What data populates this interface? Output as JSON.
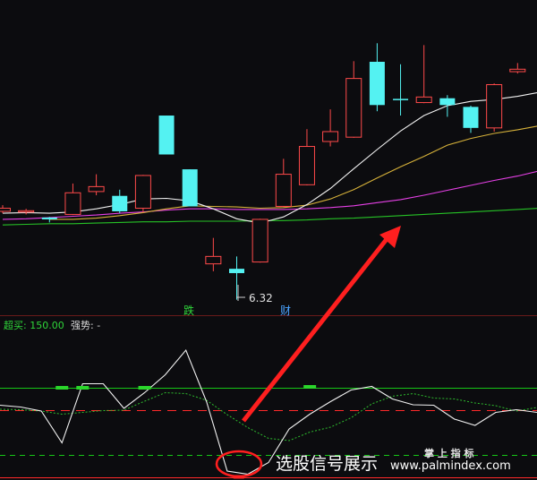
{
  "chart_data": {
    "type": "candlestick",
    "main": {
      "low_label": "6.32",
      "event_labels": [
        {
          "text": "跌",
          "color": "#2fd63a"
        },
        {
          "text": "财",
          "color": "#4aa3ff"
        }
      ],
      "candles": [
        {
          "o": 7.8,
          "c": 7.75,
          "h": 7.85,
          "l": 7.72,
          "color": "up"
        },
        {
          "o": 7.74,
          "c": 7.76,
          "h": 7.79,
          "l": 7.7,
          "color": "up"
        },
        {
          "o": 7.65,
          "c": 7.62,
          "h": 7.66,
          "l": 7.57,
          "color": "down"
        },
        {
          "o": 7.7,
          "c": 8.05,
          "h": 8.2,
          "l": 7.69,
          "color": "up"
        },
        {
          "o": 8.07,
          "c": 8.15,
          "h": 8.35,
          "l": 8.01,
          "color": "up"
        },
        {
          "o": 8.0,
          "c": 7.75,
          "h": 8.1,
          "l": 7.72,
          "color": "down"
        },
        {
          "o": 7.8,
          "c": 8.33,
          "h": 8.34,
          "l": 7.73,
          "color": "up"
        },
        {
          "o": 9.3,
          "c": 8.67,
          "h": 9.3,
          "l": 8.67,
          "color": "down"
        },
        {
          "o": 8.43,
          "c": 7.83,
          "h": 8.43,
          "l": 7.83,
          "color": "down"
        },
        {
          "o": 6.9,
          "c": 7.02,
          "h": 7.32,
          "l": 6.78,
          "color": "up"
        },
        {
          "o": 6.82,
          "c": 6.75,
          "h": 7.02,
          "l": 6.32,
          "color": "down"
        },
        {
          "o": 6.93,
          "c": 7.62,
          "h": 7.63,
          "l": 6.92,
          "color": "up"
        },
        {
          "o": 7.83,
          "c": 8.35,
          "h": 8.6,
          "l": 7.82,
          "color": "up"
        },
        {
          "o": 8.18,
          "c": 8.8,
          "h": 9.08,
          "l": 8.17,
          "color": "up"
        },
        {
          "o": 8.88,
          "c": 9.04,
          "h": 9.4,
          "l": 8.8,
          "color": "up"
        },
        {
          "o": 8.95,
          "c": 9.9,
          "h": 10.18,
          "l": 8.94,
          "color": "up"
        },
        {
          "o": 10.17,
          "c": 9.47,
          "h": 10.47,
          "l": 9.37,
          "color": "down"
        },
        {
          "o": 9.55,
          "c": 9.57,
          "h": 10.13,
          "l": 9.3,
          "color": "down"
        },
        {
          "o": 9.51,
          "c": 9.6,
          "h": 10.44,
          "l": 9.5,
          "color": "up"
        },
        {
          "o": 9.58,
          "c": 9.47,
          "h": 9.63,
          "l": 9.28,
          "color": "down"
        },
        {
          "o": 9.44,
          "c": 9.1,
          "h": 9.46,
          "l": 9.02,
          "color": "down"
        },
        {
          "o": 9.1,
          "c": 9.8,
          "h": 9.82,
          "l": 9.04,
          "color": "up"
        },
        {
          "o": 10.01,
          "c": 10.05,
          "h": 10.15,
          "l": 9.98,
          "color": "up"
        }
      ],
      "ma_white": [
        7.72,
        7.73,
        7.72,
        7.74,
        7.79,
        7.86,
        7.95,
        7.96,
        7.92,
        7.79,
        7.63,
        7.56,
        7.66,
        7.86,
        8.12,
        8.44,
        8.75,
        9.05,
        9.3,
        9.46,
        9.53,
        9.56,
        9.61,
        9.68
      ],
      "ma_yellow": [
        null,
        null,
        7.62,
        7.62,
        7.64,
        7.68,
        7.73,
        7.79,
        7.84,
        7.83,
        7.82,
        7.8,
        7.81,
        7.85,
        7.95,
        8.1,
        8.29,
        8.47,
        8.64,
        8.82,
        8.93,
        9.01,
        9.07,
        9.14
      ],
      "ma_magenta": [
        7.62,
        7.63,
        7.65,
        7.67,
        7.69,
        7.72,
        7.74,
        7.77,
        7.79,
        7.79,
        7.78,
        7.78,
        7.78,
        7.79,
        7.81,
        7.84,
        7.89,
        7.94,
        8.01,
        8.09,
        8.17,
        8.25,
        8.32,
        8.41
      ],
      "ma_green": [
        7.53,
        7.54,
        7.55,
        7.55,
        7.56,
        7.57,
        7.58,
        7.58,
        7.59,
        7.59,
        7.59,
        7.6,
        7.6,
        7.61,
        7.63,
        7.64,
        7.66,
        7.68,
        7.7,
        7.72,
        7.74,
        7.76,
        7.78,
        7.8
      ]
    },
    "indicator": {
      "label_overbuy": "超买: 150.00",
      "label_strength": "强势: -",
      "lines": [
        {
          "value": 150,
          "color": "#16c716",
          "dash": "none"
        },
        {
          "value": 100,
          "color": "#ff2a2a",
          "dash": "10,7"
        },
        {
          "value": 0,
          "color": "#16c716",
          "dash": "6,5"
        },
        {
          "value": -50,
          "color": "#ff2a2a",
          "dash": "none"
        }
      ],
      "ylim": [
        -55,
        305
      ],
      "white": [
        112,
        108,
        99,
        28,
        160,
        160,
        105,
        140,
        180,
        235,
        120,
        -35,
        -42,
        -16,
        59,
        92,
        120,
        146,
        154,
        126,
        113,
        112,
        81,
        67,
        96,
        102,
        96
      ],
      "green": [
        103,
        102,
        99,
        92,
        96,
        100,
        101,
        121,
        140,
        138,
        123,
        91,
        62,
        38,
        33,
        52,
        63,
        84,
        115,
        132,
        138,
        128,
        126,
        117,
        111,
        99,
        107
      ],
      "green_markers": [
        {
          "i": 3,
          "v": 151
        },
        {
          "i": 4,
          "v": 151
        },
        {
          "i": 7,
          "v": 151
        },
        {
          "i": 15,
          "v": 153
        }
      ],
      "red_marker": {
        "i": 10,
        "v": -48
      }
    },
    "watermark": {
      "cn": "选股信号展示",
      "brand": "掌 上 指 标",
      "url": "www.palmindex.com"
    }
  }
}
